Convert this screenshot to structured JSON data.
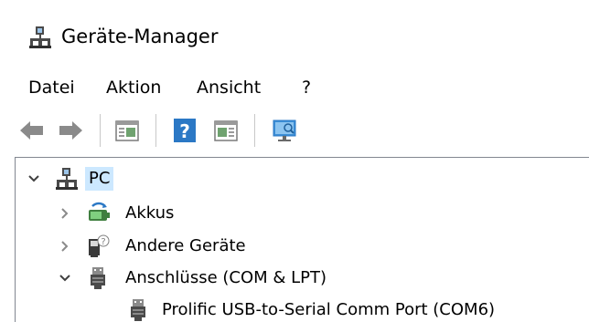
{
  "window": {
    "title": "Geräte-Manager"
  },
  "menu": {
    "items": [
      {
        "label": "Datei"
      },
      {
        "label": "Aktion"
      },
      {
        "label": "Ansicht"
      },
      {
        "label": "?"
      }
    ]
  },
  "toolbar": {
    "buttons": [
      {
        "icon": "back-arrow-icon"
      },
      {
        "icon": "forward-arrow-icon"
      },
      {
        "icon": "properties-icon"
      },
      {
        "icon": "help-icon"
      },
      {
        "icon": "update-driver-icon"
      },
      {
        "icon": "scan-hardware-icon"
      }
    ]
  },
  "tree": {
    "root": {
      "label": "PC",
      "expanded": true,
      "selected": true,
      "icon": "computer-icon"
    },
    "children": [
      {
        "label": "Akkus",
        "expanded": false,
        "icon": "battery-icon"
      },
      {
        "label": "Andere Geräte",
        "expanded": false,
        "icon": "unknown-device-icon"
      },
      {
        "label": "Anschlüsse (COM & LPT)",
        "expanded": true,
        "icon": "port-icon"
      },
      {
        "label": "Prolific USB-to-Serial Comm Port (COM6)",
        "icon": "port-icon"
      }
    ]
  },
  "colors": {
    "selection": "#cce8ff",
    "border": "#828790",
    "toolbar_blue": "#2b78c5"
  }
}
